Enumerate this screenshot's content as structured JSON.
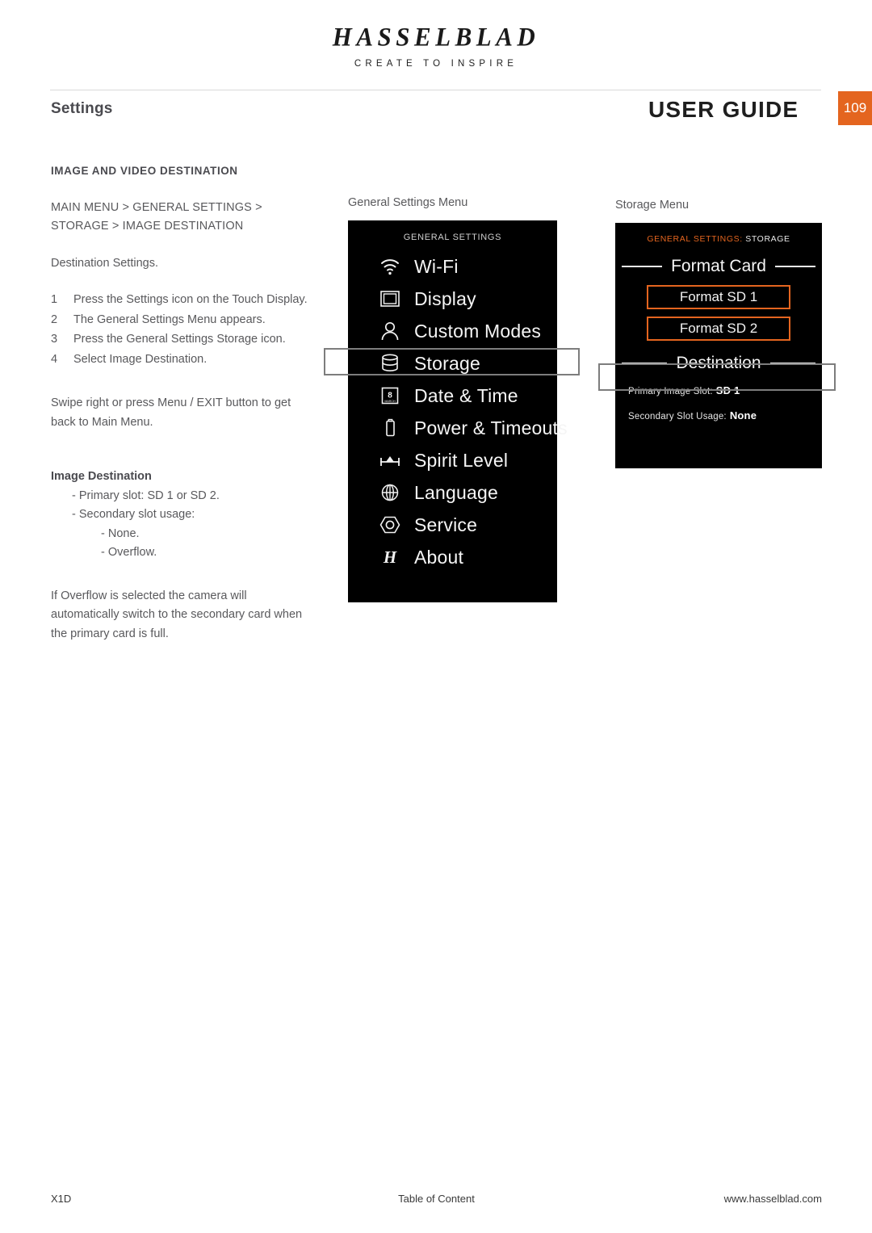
{
  "brand": {
    "name": "HASSELBLAD",
    "tagline": "CREATE TO INSPIRE"
  },
  "header": {
    "section_title": "Settings",
    "document_title": "USER GUIDE",
    "page_number": "109",
    "accent_color": "#e4651f"
  },
  "left_column": {
    "kicker": "IMAGE AND VIDEO DESTINATION",
    "path_line_1": "MAIN MENU > GENERAL SETTINGS >",
    "path_line_2": "STORAGE > IMAGE DESTINATION",
    "intro": "Destination Settings.",
    "steps": [
      {
        "num": "1",
        "text": "Press the Settings icon on the Touch Display."
      },
      {
        "num": "2",
        "text": "The General Settings Menu appears."
      },
      {
        "num": "3",
        "text": "Press the General Settings Storage icon."
      },
      {
        "num": "4",
        "text": "Select Image Destination."
      }
    ],
    "note": "Swipe right or press Menu / EXIT button to get back to Main Menu.",
    "dest_heading": "Image Destination",
    "dest_items": [
      "- Primary slot: SD 1 or SD 2.",
      "- Secondary slot usage:"
    ],
    "dest_subitems": [
      "- None.",
      "- Overflow."
    ],
    "overflow_note": "If Overflow is selected the camera will automatically switch to the secondary card when the primary card is full."
  },
  "general_settings_screen": {
    "caption": "General Settings Menu",
    "header": "GENERAL SETTINGS",
    "items": [
      {
        "label": "Wi-Fi",
        "icon": "wifi-icon"
      },
      {
        "label": "Display",
        "icon": "display-icon"
      },
      {
        "label": "Custom Modes",
        "icon": "person-icon"
      },
      {
        "label": "Storage",
        "icon": "database-icon"
      },
      {
        "label": "Date & Time",
        "icon": "calendar-icon"
      },
      {
        "label": "Power & Timeouts",
        "icon": "battery-icon"
      },
      {
        "label": "Spirit Level",
        "icon": "spirit-level-icon"
      },
      {
        "label": "Language",
        "icon": "globe-icon"
      },
      {
        "label": "Service",
        "icon": "hexagon-icon"
      },
      {
        "label": "About",
        "icon": "hasselblad-h-icon"
      }
    ],
    "calendar_day": "8",
    "calendar_month": "MARCH",
    "highlighted_item": "Storage"
  },
  "storage_screen": {
    "caption": "Storage Menu",
    "header_prefix": "GENERAL SETTINGS:",
    "header_suffix": "STORAGE",
    "format_card_title": "Format Card",
    "format_buttons": [
      "Format SD 1",
      "Format SD 2"
    ],
    "destination_title": "Destination",
    "destination_rows": [
      {
        "label": "Primary Image Slot:",
        "value": "SD 1"
      },
      {
        "label": "Secondary Slot Usage:",
        "value": "None"
      }
    ],
    "button_border_color": "#e4651f"
  },
  "footer": {
    "left": "X1D",
    "middle": "Table of Content",
    "right": "www.hasselblad.com"
  }
}
